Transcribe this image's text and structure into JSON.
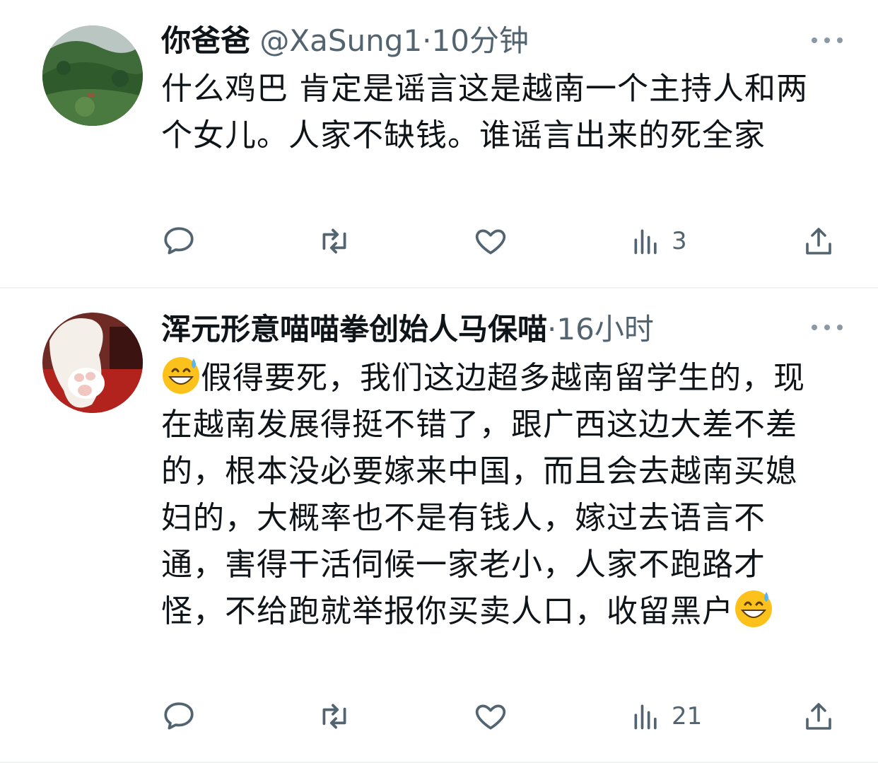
{
  "tweets": [
    {
      "name": "你爸爸",
      "handle": "@XaSung1",
      "separator": "·",
      "time": "10分钟",
      "text": "什么鸡巴 肯定是谣言这是越南一个主持人和两个女儿。人家不缺钱。谁谣言出来的死全家",
      "views": "3",
      "avatar_icon": "landscape-photo"
    },
    {
      "name": "浑元形意喵喵拳创始人马保喵",
      "handle": "",
      "separator": "·",
      "time": "16小时",
      "text_main": "假得要死，我们这边超多越南留学生的，现在越南发展得挺不错了，跟广西这边大差不差的，根本没必要嫁来中国，而且会去越南买媳妇的，大概率也不是有钱人，嫁过去语言不通，害得干活伺候一家老小，人家不跑路才怪，不给跑就举报你买卖人口，收留黑户",
      "emoji": "grinning-face-with-sweat",
      "views": "21",
      "avatar_icon": "cat-paw-photo"
    }
  ],
  "colors": {
    "text": "#0f1419",
    "secondary": "#536471",
    "divider": "#eff3f4"
  }
}
